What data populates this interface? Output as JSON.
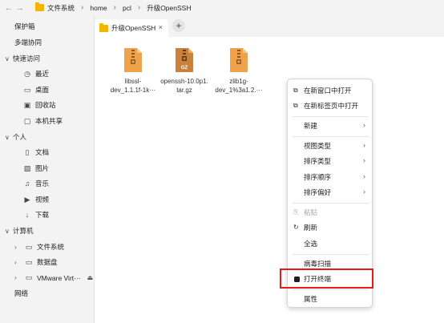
{
  "titlebar": {
    "back_icon": "←",
    "forward_icon": "→",
    "breadcrumbs": [
      "文件系统",
      "home",
      "pcl",
      "升级OpenSSH"
    ],
    "separator": "›"
  },
  "sidebar": {
    "items": [
      {
        "label": "保护箱"
      },
      {
        "label": "多端协同"
      },
      {
        "label": "快速访问",
        "chevron": "∨"
      },
      {
        "label": "最近",
        "icon": "◷"
      },
      {
        "label": "桌面",
        "icon": "▭"
      },
      {
        "label": "回收站",
        "icon": "▣"
      },
      {
        "label": "本机共享",
        "icon": "▢"
      },
      {
        "label": "个人",
        "chevron": "∨"
      },
      {
        "label": "文档",
        "icon": "▯"
      },
      {
        "label": "图片",
        "icon": "▨"
      },
      {
        "label": "音乐",
        "icon": "♫"
      },
      {
        "label": "视频",
        "icon": "▶"
      },
      {
        "label": "下载",
        "icon": "↓"
      },
      {
        "label": "计算机",
        "chevron": "∨"
      },
      {
        "label": "文件系统",
        "chevron": "›",
        "icon": "▭"
      },
      {
        "label": "数据盘",
        "chevron": "›",
        "icon": "▭"
      },
      {
        "label": "VMware Virt···",
        "chevron": "›",
        "icon": "▭",
        "eject": "⏏"
      },
      {
        "label": "网络"
      }
    ]
  },
  "tabs": {
    "active_label": "升级OpenSSH",
    "close_icon": "×",
    "add_icon": "+"
  },
  "files": [
    {
      "line1": "libssl-",
      "line2": "dev_1.1.1f-1k···",
      "badge": ""
    },
    {
      "line1": "openssh-10.0p1.",
      "line2": "tar.gz",
      "badge": "GZ"
    },
    {
      "line1": "zlib1g-",
      "line2": "dev_1%3a1.2.···",
      "badge": ""
    }
  ],
  "context_menu": {
    "open_new_window": "在新窗口中打开",
    "open_new_tab": "在新标签页中打开",
    "new": "新建",
    "view_type": "视图类型",
    "sort_type": "排序类型",
    "sort_order": "排序顺序",
    "sort_pref": "排序偏好",
    "paste": "粘贴",
    "refresh": "刷新",
    "select_all": "全选",
    "virus_scan": "病毒扫描",
    "open_terminal": "打开终端",
    "properties": "属性",
    "submenu_arrow": "›",
    "icon_new_window": "⧉",
    "icon_new_tab": "⧉",
    "icon_paste": "⎘",
    "icon_refresh": "↻"
  },
  "colors": {
    "folder": "#f5b400",
    "archive": "#f0a24a",
    "highlight_border": "#e8191c"
  }
}
